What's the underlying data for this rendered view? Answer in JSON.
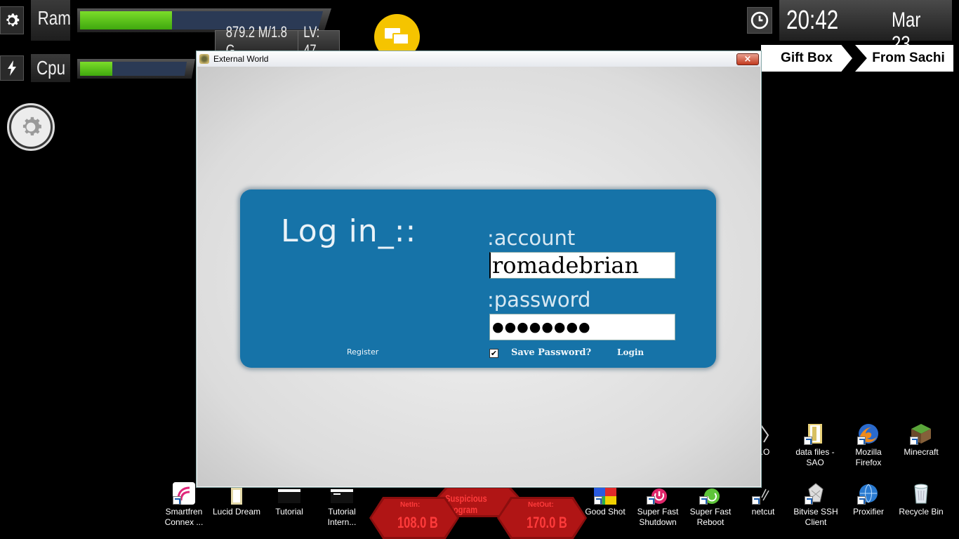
{
  "gauges": {
    "ram": {
      "label": "Ram",
      "fill_percent": 38
    },
    "cpu": {
      "label": "Cpu",
      "fill_percent": 30
    },
    "memory_text": "879.2 M/1.8 G",
    "level_text": "LV: 47"
  },
  "clock": {
    "time": "20:42",
    "date": "Mar 23"
  },
  "tabs": {
    "gift_box": "Gift Box",
    "from_sachi": "From Sachi"
  },
  "window": {
    "title": "External World",
    "close_label": "×"
  },
  "login": {
    "heading": "Log in_::",
    "account_label": ":account",
    "account_value": "romadebrian",
    "password_label": ":password",
    "password_value": "●●●●●●●●",
    "register_label": "Register",
    "save_password_label": "Save Password?",
    "save_password_checked": true,
    "login_label": "Login"
  },
  "desktop_icons_right": [
    {
      "label": ".O",
      "icon": "partial-icon"
    },
    {
      "label": "data files - SAO",
      "icon": "folder-icon"
    },
    {
      "label": "Mozilla Firefox",
      "icon": "firefox-icon"
    },
    {
      "label": "Minecraft",
      "icon": "minecraft-icon"
    }
  ],
  "taskbar_icons": [
    {
      "label": "Smartfren Connex ...",
      "icon": "smartfren-icon"
    },
    {
      "label": "Lucid Dream",
      "icon": "document-icon"
    },
    {
      "label": "Tutorial",
      "icon": "window-icon"
    },
    {
      "label": "Tutorial Intern...",
      "icon": "window-icon"
    },
    {
      "label": "Good Shot",
      "icon": "good-shot-icon"
    },
    {
      "label": "Super Fast Shutdown",
      "icon": "shutdown-icon"
    },
    {
      "label": "Super Fast Reboot",
      "icon": "reboot-icon"
    },
    {
      "label": "netcut",
      "icon": "netcut-icon"
    },
    {
      "label": "Bitvise SSH Client",
      "icon": "ssh-icon"
    },
    {
      "label": "Proxifier",
      "icon": "proxifier-icon"
    },
    {
      "label": "Recycle Bin",
      "icon": "recycle-bin-icon"
    }
  ],
  "network": {
    "suspicious_label": "Suspicious Program",
    "netin_label": "NetIn:",
    "netin_value": "108.0 B",
    "netout_label": "NetOut:",
    "netout_value": "170.0 B"
  },
  "colors": {
    "panel_blue": "#1673a8",
    "gauge_green": "#5cc71c",
    "alert_red": "#b01515",
    "chat_yellow": "#f5c400"
  }
}
